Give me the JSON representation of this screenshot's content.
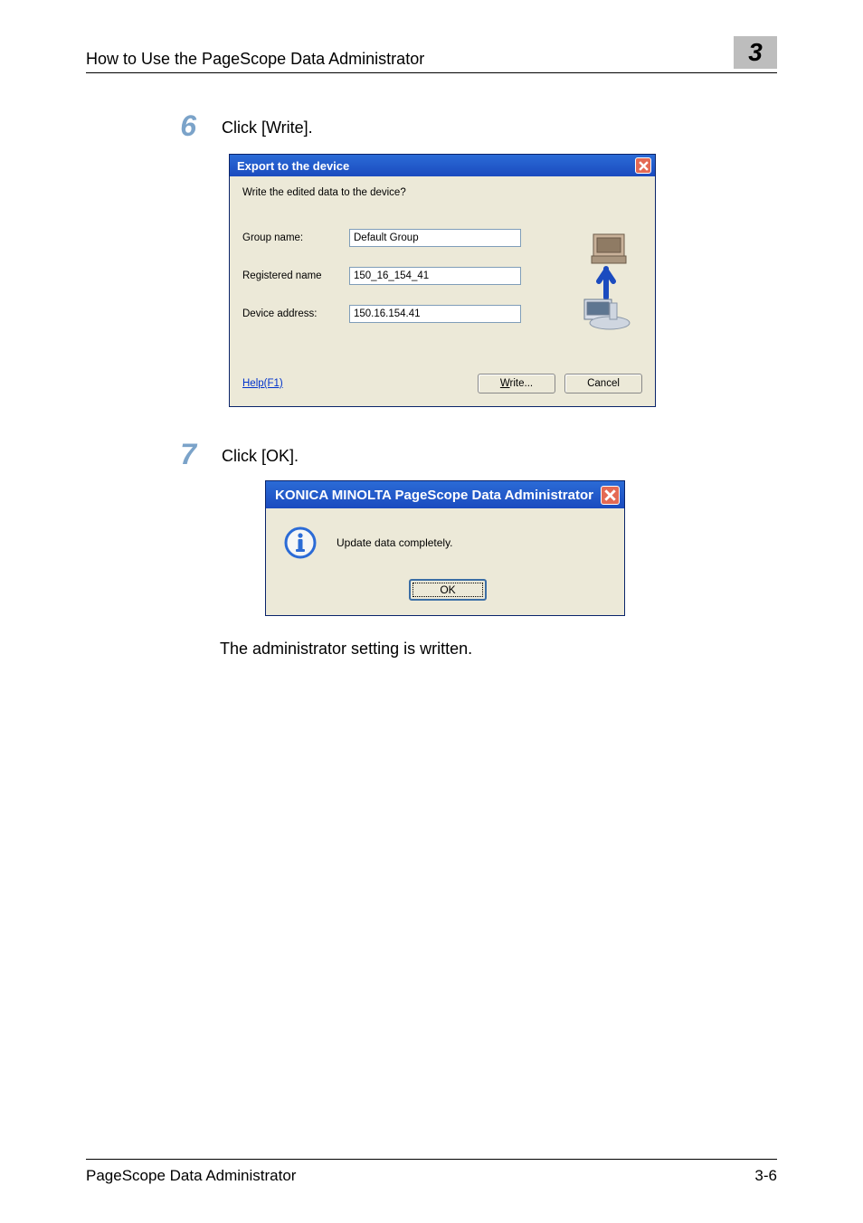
{
  "header": {
    "title": "How to Use the PageScope Data Administrator",
    "chapter_number": "3"
  },
  "steps": {
    "six": {
      "number": "6",
      "instruction": "Click [Write]."
    },
    "seven": {
      "number": "7",
      "instruction": "Click [OK]."
    }
  },
  "dialog_export": {
    "title": "Export to the device",
    "prompt": "Write the edited data to the device?",
    "fields": {
      "group_name_label": "Group name:",
      "group_name_value": "Default Group",
      "registered_name_label": "Registered name",
      "registered_name_value": "150_16_154_41",
      "device_address_label": "Device address:",
      "device_address_value": "150.16.154.41"
    },
    "help_link": "Help(F1)",
    "write_button_prefix": "W",
    "write_button_suffix": "rite...",
    "cancel_button": "Cancel"
  },
  "dialog_confirm": {
    "title": "KONICA MINOLTA PageScope Data Administrator",
    "message": "Update data completely.",
    "ok_button": "OK"
  },
  "conclusion_text": "The administrator setting is written.",
  "footer": {
    "product": "PageScope Data Administrator",
    "page": "3-6"
  }
}
